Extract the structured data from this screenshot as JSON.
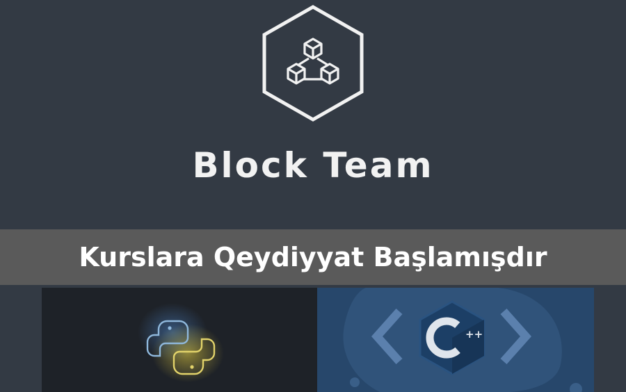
{
  "brand": {
    "name": "Block Team",
    "logo_icon": "hexagon-cubes-icon"
  },
  "banner": {
    "text": "Kurslara Qeydiyyat Başlamışdır"
  },
  "courses": [
    {
      "icon": "python-logo-icon",
      "accent": "#f5d547"
    },
    {
      "icon": "cpp-logo-icon",
      "label": "C",
      "suffix": "++",
      "accent": "#5b80ad"
    }
  ],
  "colors": {
    "background": "#333a44",
    "banner": "#5a5a5a",
    "python_card": "#1e2228",
    "cpp_card": "#27476b"
  }
}
